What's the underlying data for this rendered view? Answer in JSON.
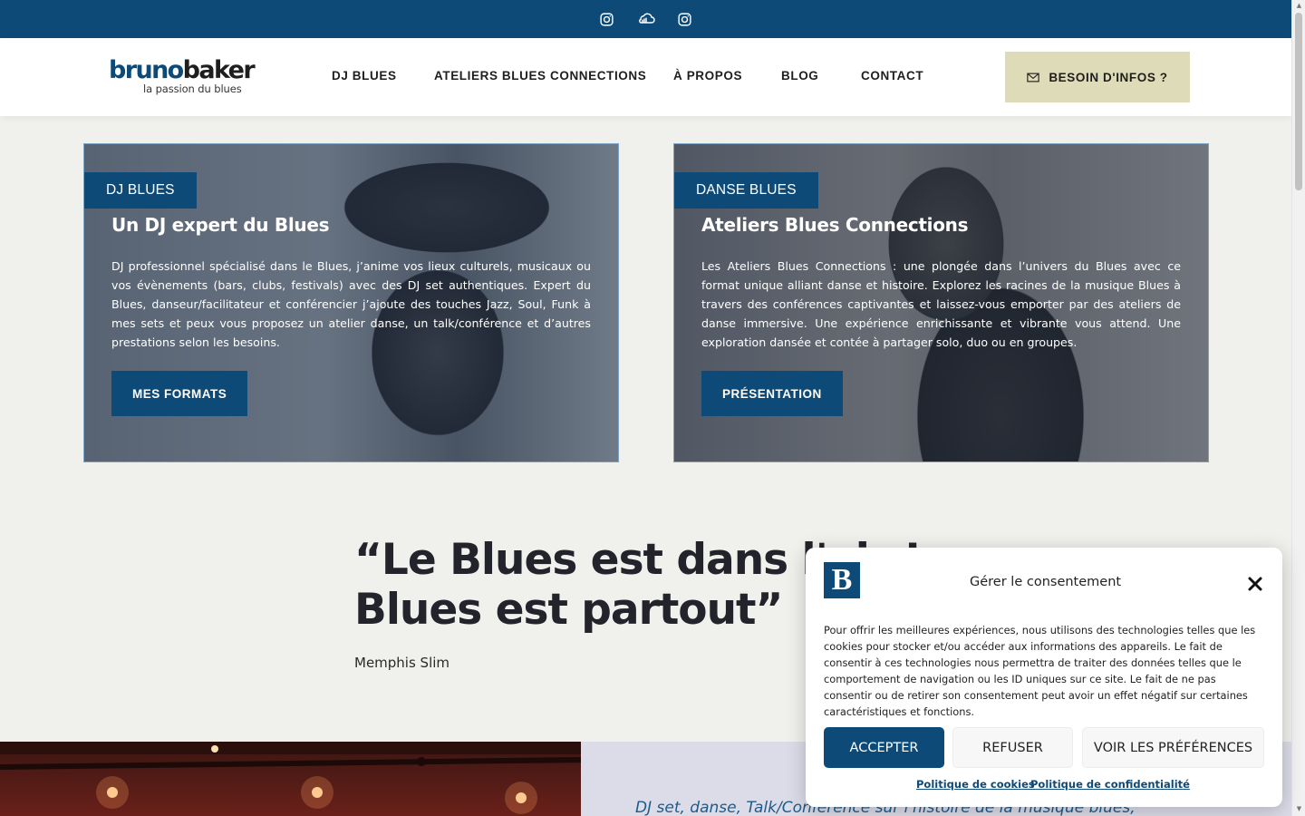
{
  "topbar": {
    "icons": [
      "instagram-icon",
      "soundcloud-icon",
      "instagram-icon"
    ],
    "color": "#0d4a77"
  },
  "header": {
    "logo_part1": "bruno",
    "logo_part2": "baker",
    "logo_tagline": "la passion du blues",
    "nav": [
      "DJ BLUES",
      "ATELIERS BLUES CONNECTIONS",
      "À PROPOS",
      "BLOG",
      "CONTACT"
    ],
    "cta_label": "BESOIN D'INFOS ?",
    "cta_icon": "envelope-icon"
  },
  "cards": [
    {
      "tag": "DJ BLUES",
      "title": "Un DJ expert du Blues",
      "text": "DJ professionnel spécialisé dans le Blues, j’anime vos lieux culturels, musicaux ou vos évènements (bars, clubs, festivals) avec des DJ set authentiques. Expert du Blues, danseur/facilitateur et conférencier j’ajoute des touches Jazz, Soul, Funk à mes sets et peux vous proposez un atelier danse, un talk/conférence et d’autres  prestations selon les besoins.",
      "button": "MES FORMATS"
    },
    {
      "tag": "DANSE BLUES",
      "title": "Ateliers Blues Connections",
      "text": "Les Ateliers Blues Connections : une plongée dans l’univers du Blues avec ce format unique alliant danse et histoire. Explorez les racines de la musique Blues à travers des conférences captivantes et laissez-vous emporter par des ateliers de danse immersive. Une expérience enrichissante et vibrante vous attend. Une exploration dansée et contée à partager solo, duo ou en groupes.",
      "button": "PRÉSENTATION"
    }
  ],
  "quote": {
    "line1": "“Le Blues est dans l'air !",
    "line2": "Blues est partout”",
    "author": "Memphis Slim"
  },
  "bottom": {
    "text": "DJ set, danse, Talk/Conférence sur l'histoire de la musique blues,"
  },
  "consent": {
    "logo_letter": "B",
    "title": "Gérer le consentement",
    "text": "Pour offrir les meilleures expériences, nous utilisons des technologies telles que les cookies pour stocker et/ou accéder aux informations des appareils. Le fait de consentir à ces technologies nous permettra de traiter des données telles que le comportement de navigation ou les ID uniques sur ce site. Le fait de ne pas consentir ou de retirer son consentement peut avoir un effet négatif sur certaines caractéristiques et fonctions.",
    "accept": "ACCEPTER",
    "refuse": "REFUSER",
    "preferences": "VOIR LES PRÉFÉRENCES",
    "link_cookies": "Politique de cookies",
    "link_privacy": "Politique de confidentialité"
  },
  "colors": {
    "brand": "#0d4a77",
    "cta_bg": "#dedcb8",
    "page_bg": "#f0f0ec"
  }
}
